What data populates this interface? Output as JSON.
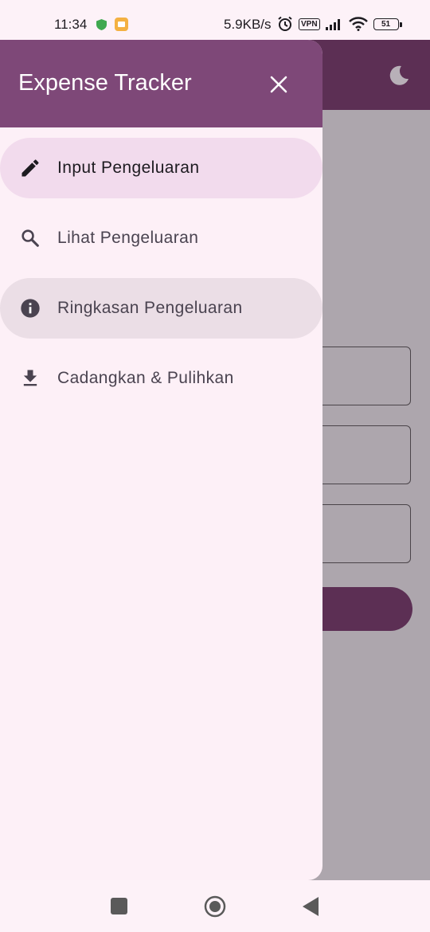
{
  "status_bar": {
    "time": "11:34",
    "network_speed": "5.9KB/s",
    "vpn": "VPN",
    "battery": "51"
  },
  "drawer": {
    "title": "Expense Tracker",
    "items": [
      {
        "label": "Input Pengeluaran",
        "icon": "pencil-icon",
        "state": "selected"
      },
      {
        "label": "Lihat Pengeluaran",
        "icon": "search-icon",
        "state": "normal"
      },
      {
        "label": "Ringkasan Pengeluaran",
        "icon": "info-icon",
        "state": "focused"
      },
      {
        "label": "Cadangkan & Pulihkan",
        "icon": "download-icon",
        "state": "normal"
      }
    ]
  },
  "colors": {
    "header": "#7e4878",
    "appbar": "#5c2f54",
    "selected_item": "#f2dbed",
    "drawer_bg": "#fdf0f7",
    "scrim_bg": "#ada6ad"
  }
}
